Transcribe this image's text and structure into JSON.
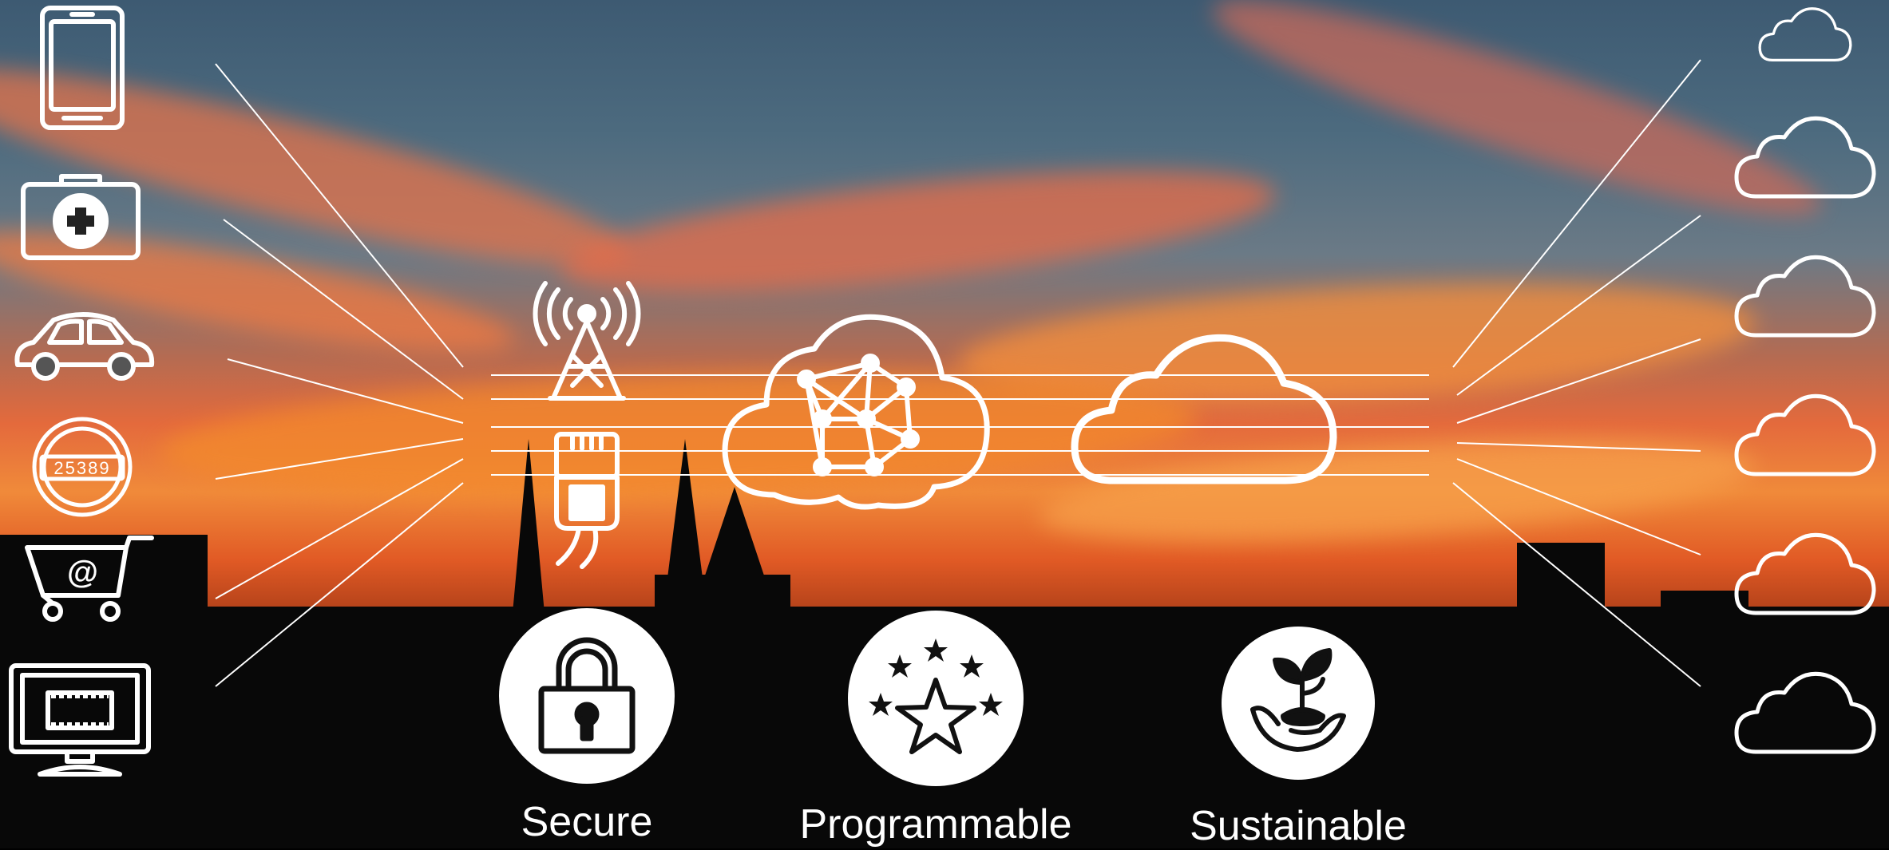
{
  "meter": {
    "reading": "25389"
  },
  "features": [
    {
      "label": "Secure",
      "icon": "padlock-icon"
    },
    {
      "label": "Programmable",
      "icon": "stars-icon"
    },
    {
      "label": "Sustainable",
      "icon": "plant-in-hand-icon"
    }
  ],
  "devices": [
    "smartphone-icon",
    "first-aid-kit-icon",
    "car-icon",
    "utility-meter-icon",
    "shopping-cart-icon",
    "monitor-icon"
  ],
  "network": [
    "cell-tower-icon",
    "ethernet-cable-icon",
    "network-cloud-icon",
    "cloud-icon"
  ],
  "clouds": [
    "cloud-icon",
    "cloud-icon",
    "cloud-icon",
    "cloud-icon",
    "cloud-icon",
    "cloud-icon"
  ],
  "colors": {
    "icon_stroke": "#ffffff",
    "feature_fill": "#ffffff",
    "feature_icon": "#111111"
  }
}
